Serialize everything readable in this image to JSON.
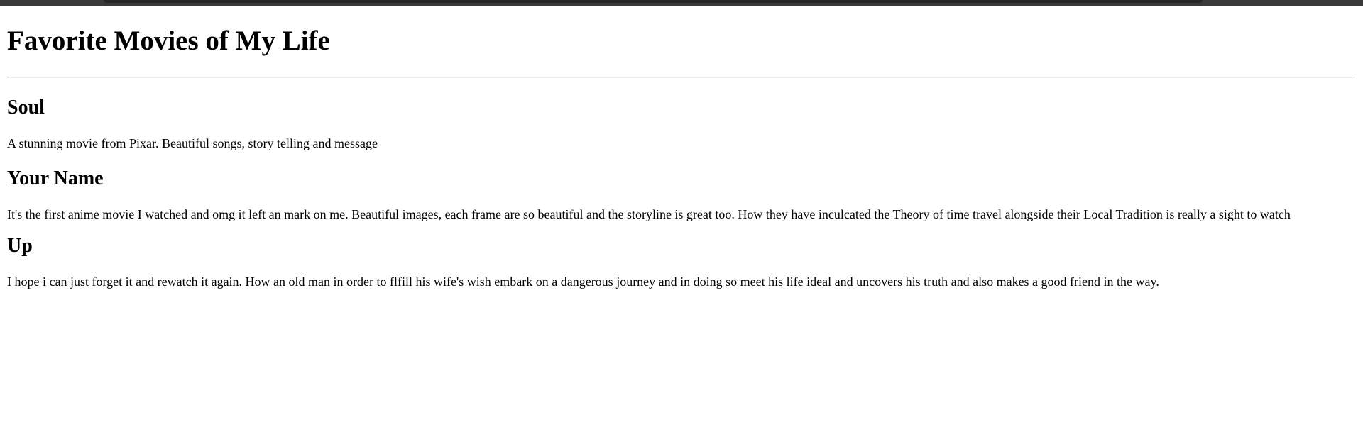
{
  "page": {
    "title": "Favorite Movies of My Life"
  },
  "movies": [
    {
      "title": "Soul",
      "description": "A stunning movie from Pixar. Beautiful songs, story telling and message"
    },
    {
      "title": "Your Name",
      "description": "It's the first anime movie I watched and omg it left an mark on me. Beautiful images, each frame are so beautiful and the storyline is great too. How they have inculcated the Theory of time travel alongside their Local Tradition is really a sight to watch"
    },
    {
      "title": "Up",
      "description": "I hope i can just forget it and rewatch it again. How an old man in order to flfill his wife's wish embark on a dangerous journey and in doing so meet his life ideal and uncovers his truth and also makes a good friend in the way."
    }
  ],
  "colors": {
    "background": "#ffffff",
    "text": "#000000",
    "divider": "#9a9a9a",
    "browser_chrome": "#3a3a3a"
  }
}
